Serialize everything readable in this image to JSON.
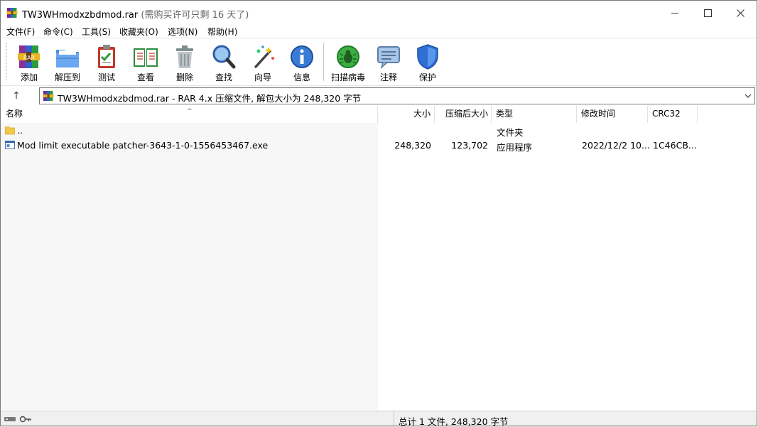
{
  "window": {
    "title": "TW3WHmodxzbdmod.rar",
    "title_suffix": "(需购买许可只剩 16 天了)",
    "controls": {
      "minimize": "minimize-icon",
      "maximize": "maximize-icon",
      "close": "close-icon"
    }
  },
  "menu": [
    {
      "label": "文件(F)"
    },
    {
      "label": "命令(C)"
    },
    {
      "label": "工具(S)"
    },
    {
      "label": "收藏夹(O)"
    },
    {
      "label": "选项(N)"
    },
    {
      "label": "帮助(H)"
    }
  ],
  "toolbar": [
    {
      "label": "添加",
      "icon": "add-archive-icon"
    },
    {
      "label": "解压到",
      "icon": "extract-folder-icon"
    },
    {
      "label": "测试",
      "icon": "test-clipboard-icon"
    },
    {
      "label": "查看",
      "icon": "view-book-icon"
    },
    {
      "label": "删除",
      "icon": "trash-icon"
    },
    {
      "label": "查找",
      "icon": "magnifier-icon"
    },
    {
      "label": "向导",
      "icon": "wizard-wand-icon"
    },
    {
      "label": "信息",
      "icon": "info-icon"
    },
    {
      "label": "扫描病毒",
      "icon": "virus-scan-icon"
    },
    {
      "label": "注释",
      "icon": "comment-icon"
    },
    {
      "label": "保护",
      "icon": "shield-icon"
    }
  ],
  "addressbar": {
    "up": "↑",
    "path": "TW3WHmodxzbdmod.rar - RAR 4.x 压缩文件, 解包大小为 248,320 字节"
  },
  "columns": {
    "name": "名称",
    "size": "大小",
    "packed": "压缩后大小",
    "type": "类型",
    "modified": "修改时间",
    "crc": "CRC32"
  },
  "files": [
    {
      "name": "..",
      "size": "",
      "packed": "",
      "type": "文件夹",
      "modified": "",
      "crc": "",
      "icon": "folder-icon"
    },
    {
      "name": "Mod limit executable patcher-3643-1-0-1556453467.exe",
      "size": "248,320",
      "packed": "123,702",
      "type": "应用程序",
      "modified": "2022/12/2 10...",
      "crc": "1C46CB...",
      "icon": "exe-icon"
    }
  ],
  "status": {
    "summary": "总计 1 文件, 248,320 字节"
  },
  "colors": {
    "accent": "#1f6fd6",
    "list_bg": "#f7f7f7"
  }
}
